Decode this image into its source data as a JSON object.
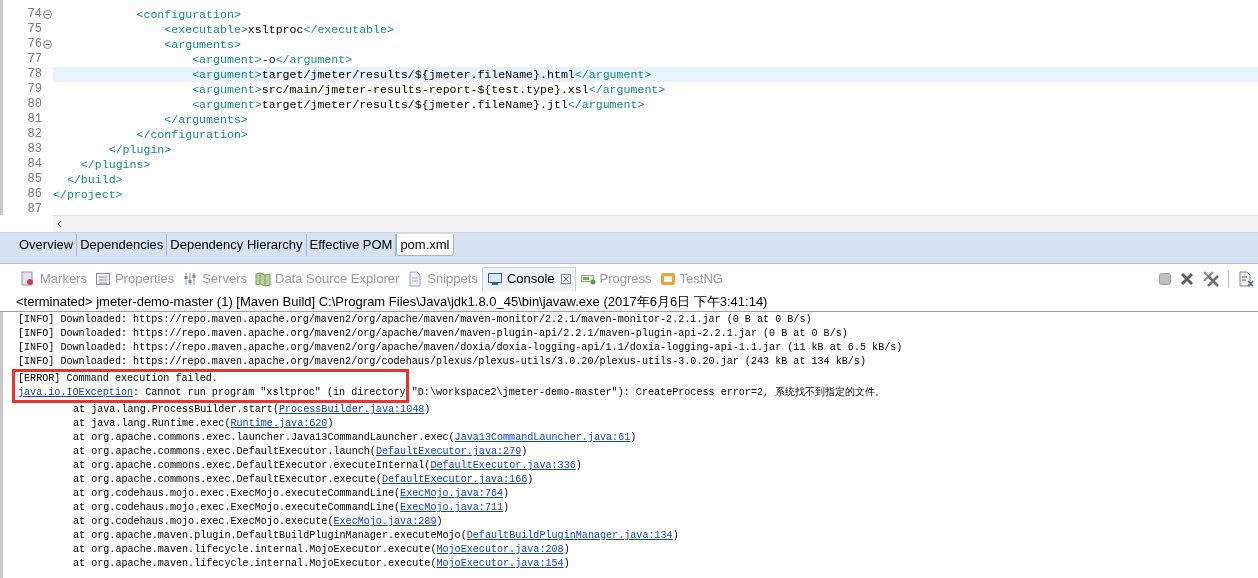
{
  "editor": {
    "lines": [
      {
        "number": "74",
        "text": "            <configuration>",
        "fold": true,
        "current": false
      },
      {
        "number": "75",
        "text": "                <executable>xsltproc</executable>",
        "fold": false,
        "current": false
      },
      {
        "number": "76",
        "text": "                <arguments>",
        "fold": true,
        "current": false
      },
      {
        "number": "77",
        "text": "                    <argument>-o</argument>",
        "fold": false,
        "current": false
      },
      {
        "number": "78",
        "text": "                    <argument>target/jmeter/results/${jmeter.fileName}.html</argument>",
        "fold": false,
        "current": true
      },
      {
        "number": "79",
        "text": "                    <argument>src/main/jmeter-results-report-${test.type}.xsl</argument>",
        "fold": false,
        "current": false
      },
      {
        "number": "80",
        "text": "                    <argument>target/jmeter/results/${jmeter.fileName}.jtl</argument>",
        "fold": false,
        "current": false
      },
      {
        "number": "81",
        "text": "                </arguments>",
        "fold": false,
        "current": false
      },
      {
        "number": "82",
        "text": "            </configuration>",
        "fold": false,
        "current": false
      },
      {
        "number": "83",
        "text": "        </plugin>",
        "fold": false,
        "current": false
      },
      {
        "number": "84",
        "text": "    </plugins>",
        "fold": false,
        "current": false
      },
      {
        "number": "85",
        "text": "  </build>",
        "fold": false,
        "current": false
      },
      {
        "number": "86",
        "text": "</project>",
        "fold": false,
        "current": false
      },
      {
        "number": "87",
        "fold": false,
        "current": false
      }
    ]
  },
  "editor_tabs": [
    {
      "label": "Overview",
      "selected": false
    },
    {
      "label": "Dependencies",
      "selected": false
    },
    {
      "label": "Dependency Hierarchy",
      "selected": false
    },
    {
      "label": "Effective POM",
      "selected": false
    },
    {
      "label": "pom.xml",
      "selected": true
    }
  ],
  "view_tabs": [
    {
      "label": "Markers",
      "kind": "markers",
      "selected": false
    },
    {
      "label": "Properties",
      "kind": "properties",
      "selected": false
    },
    {
      "label": "Servers",
      "kind": "servers",
      "selected": false
    },
    {
      "label": "Data Source Explorer",
      "kind": "datasource",
      "selected": false
    },
    {
      "label": "Snippets",
      "kind": "snippets",
      "selected": false
    },
    {
      "label": "Console",
      "kind": "console",
      "selected": true
    },
    {
      "label": "Progress",
      "kind": "progress",
      "selected": false
    },
    {
      "label": "TestNG",
      "kind": "testng",
      "selected": false
    }
  ],
  "console": {
    "header": "<terminated> jmeter-demo-master (1) [Maven Build] C:\\Program Files\\Java\\jdk1.8.0_45\\bin\\javaw.exe (2017年6月6日 下午3:41:14)",
    "lines": [
      {
        "kind": "plain",
        "boxed": false,
        "text": "[INFO] Downloaded: https://repo.maven.apache.org/maven2/org/apache/maven/maven-monitor/2.2.1/maven-monitor-2.2.1.jar (0 B at 0 B/s)"
      },
      {
        "kind": "plain",
        "boxed": false,
        "text": "[INFO] Downloaded: https://repo.maven.apache.org/maven2/org/apache/maven/maven-plugin-api/2.2.1/maven-plugin-api-2.2.1.jar (0 B at 0 B/s)"
      },
      {
        "kind": "plain",
        "boxed": false,
        "text": "[INFO] Downloaded: https://repo.maven.apache.org/maven2/org/apache/maven/doxia/doxia-logging-api/1.1/doxia-logging-api-1.1.jar (11 kB at 6.5 kB/s)"
      },
      {
        "kind": "plain",
        "boxed": false,
        "text": "[INFO] Downloaded: https://repo.maven.apache.org/maven2/org/codehaus/plexus/plexus-utils/3.0.20/plexus-utils-3.0.20.jar (243 kB at 134 kB/s)"
      },
      {
        "kind": "plain",
        "boxed": true,
        "text": "[ERROR] Command execution failed."
      },
      {
        "kind": "exception",
        "boxed": true,
        "link": "java.io.IOException",
        "text": ": Cannot run program \"xsltproc\" (in directory \"D:\\workspace2\\jmeter-demo-master\"): CreateProcess error=2, 系统找不到指定的文件。"
      },
      {
        "kind": "frame",
        "boxed": false,
        "prefix": "at java.lang.ProcessBuilder.start(",
        "link": "ProcessBuilder.java:1048",
        "suffix": ")"
      },
      {
        "kind": "frame",
        "boxed": false,
        "prefix": "at java.lang.Runtime.exec(",
        "link": "Runtime.java:620",
        "suffix": ")"
      },
      {
        "kind": "frame",
        "boxed": false,
        "prefix": "at org.apache.commons.exec.launcher.Java13CommandLauncher.exec(",
        "link": "Java13CommandLauncher.java:61",
        "suffix": ")"
      },
      {
        "kind": "frame",
        "boxed": false,
        "prefix": "at org.apache.commons.exec.DefaultExecutor.launch(",
        "link": "DefaultExecutor.java:279",
        "suffix": ")"
      },
      {
        "kind": "frame",
        "boxed": false,
        "prefix": "at org.apache.commons.exec.DefaultExecutor.executeInternal(",
        "link": "DefaultExecutor.java:336",
        "suffix": ")"
      },
      {
        "kind": "frame",
        "boxed": false,
        "prefix": "at org.apache.commons.exec.DefaultExecutor.execute(",
        "link": "DefaultExecutor.java:166",
        "suffix": ")"
      },
      {
        "kind": "frame",
        "boxed": false,
        "prefix": "at org.codehaus.mojo.exec.ExecMojo.executeCommandLine(",
        "link": "ExecMojo.java:764",
        "suffix": ")"
      },
      {
        "kind": "frame",
        "boxed": false,
        "prefix": "at org.codehaus.mojo.exec.ExecMojo.executeCommandLine(",
        "link": "ExecMojo.java:711",
        "suffix": ")"
      },
      {
        "kind": "frame",
        "boxed": false,
        "prefix": "at org.codehaus.mojo.exec.ExecMojo.execute(",
        "link": "ExecMojo.java:289",
        "suffix": ")"
      },
      {
        "kind": "frame",
        "boxed": false,
        "prefix": "at org.apache.maven.plugin.DefaultBuildPluginManager.executeMojo(",
        "link": "DefaultBuildPluginManager.java:134",
        "suffix": ")"
      },
      {
        "kind": "frame",
        "boxed": false,
        "prefix": "at org.apache.maven.lifecycle.internal.MojoExecutor.execute(",
        "link": "MojoExecutor.java:208",
        "suffix": ")"
      },
      {
        "kind": "frame",
        "boxed": false,
        "prefix": "at org.apache.maven.lifecycle.internal.MojoExecutor.execute(",
        "link": "MojoExecutor.java:154",
        "suffix": ")"
      }
    ]
  }
}
